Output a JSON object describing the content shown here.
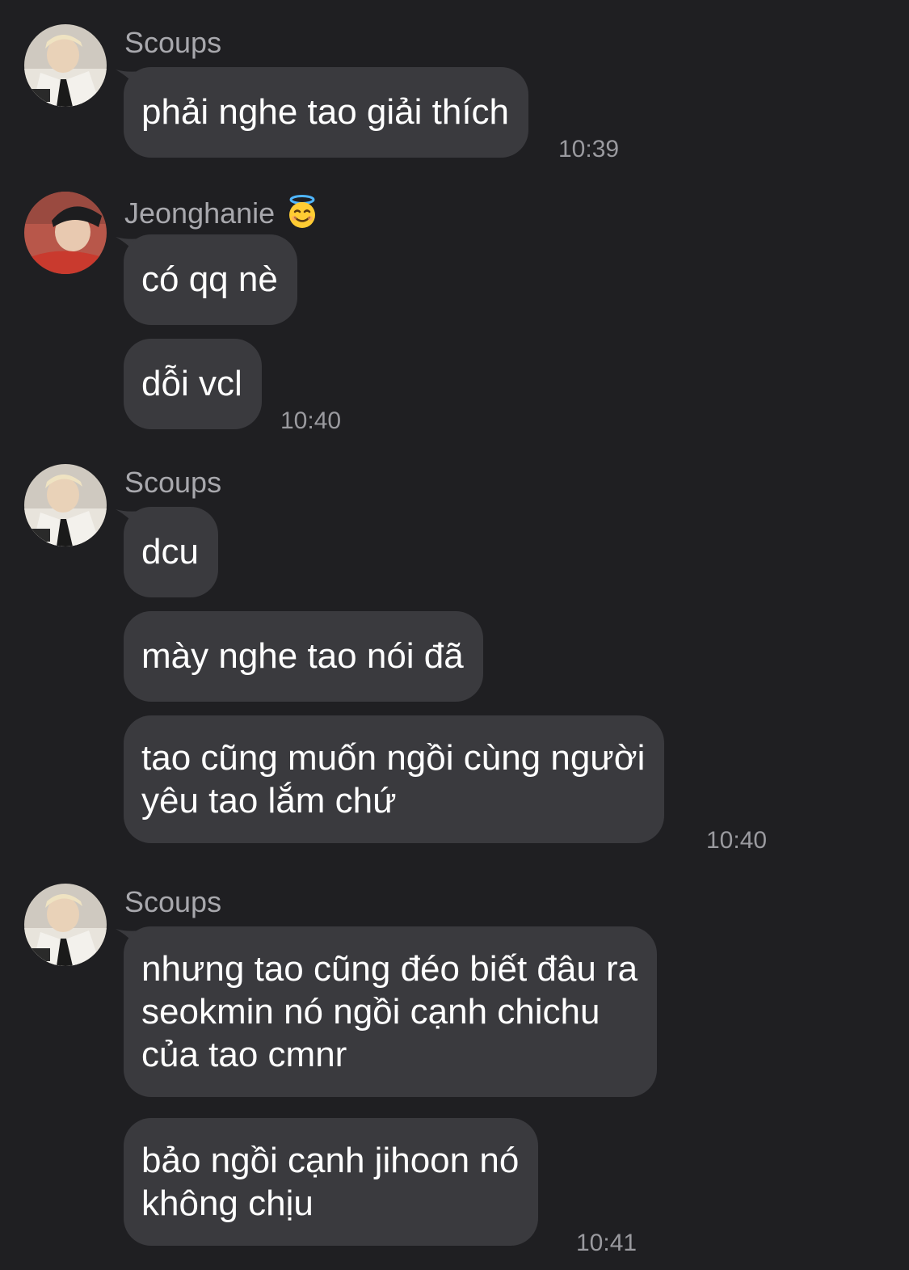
{
  "messages": [
    {
      "sender": "Scoups",
      "bubbles": [
        "phải nghe tao giải thích"
      ],
      "time": "10:39"
    },
    {
      "sender": "Jeonghanie",
      "sender_emoji": "smiling-face-with-halo-icon",
      "bubbles": [
        "có qq nè",
        "dỗi vcl"
      ],
      "time": "10:40"
    },
    {
      "sender": "Scoups",
      "bubbles": [
        "dcu",
        "mày nghe tao nói đã",
        "tao cũng muốn ngồi cùng người\nyêu tao lắm chứ"
      ],
      "time": "10:40"
    },
    {
      "sender": "Scoups",
      "bubbles": [
        "nhưng tao cũng đéo biết đâu ra\nseokmin nó ngồi cạnh chichu\ncủa tao cmnr",
        "bảo ngồi cạnh jihoon nó\nkhông chịu"
      ],
      "time": "10:41"
    }
  ],
  "colors": {
    "background": "#1f1f22",
    "bubble": "#3a3a3e",
    "sender_name": "#a8a8ad",
    "timestamp": "#9a9a9f",
    "text": "#ffffff"
  }
}
